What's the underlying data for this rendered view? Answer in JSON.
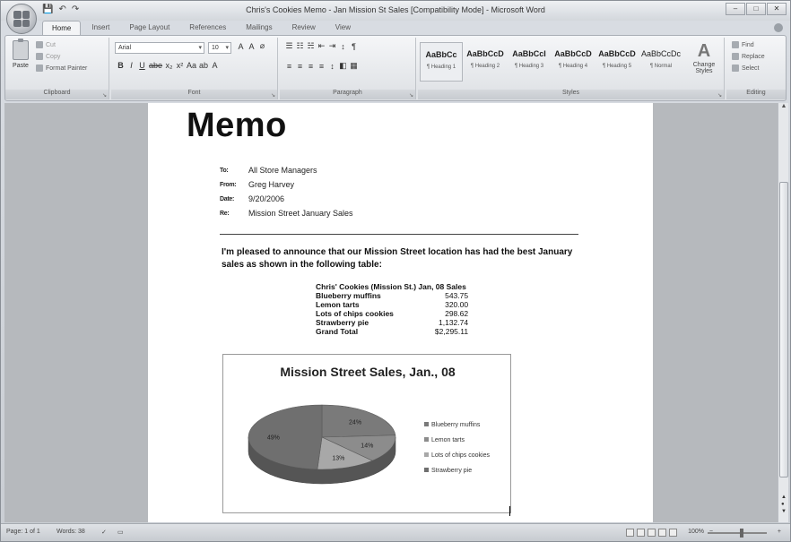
{
  "window": {
    "title": "Chris's Cookies Memo - Jan Mission St Sales [Compatibility Mode] - Microsoft Word",
    "controls": [
      "–",
      "□",
      "✕"
    ]
  },
  "quick_access": [
    "💾",
    "↶",
    "↷"
  ],
  "tabs": [
    "Home",
    "Insert",
    "Page Layout",
    "References",
    "Mailings",
    "Review",
    "View"
  ],
  "ribbon": {
    "clipboard": {
      "paste": "Paste",
      "cut": "Cut",
      "copy": "Copy",
      "format_painter": "Format Painter",
      "label": "Clipboard"
    },
    "font": {
      "family": "Arial",
      "size": "10",
      "label": "Font",
      "row1_extra": [
        "A",
        "A",
        "⌀"
      ],
      "row2": [
        "B",
        "I",
        "U",
        "abe",
        "x₂",
        "x²",
        "Aa",
        "ab",
        "A"
      ]
    },
    "paragraph": {
      "label": "Paragraph",
      "row1": [
        "☰",
        "☷",
        "☵",
        "⇤",
        "⇥",
        "↕",
        "¶"
      ],
      "row2": [
        "≡",
        "≡",
        "≡",
        "≡",
        "↕",
        "◧",
        "▦"
      ]
    },
    "styles": {
      "label": "Styles",
      "items": [
        {
          "sample": "AaBbCc",
          "name": "¶ Heading 1"
        },
        {
          "sample": "AaBbCcD",
          "name": "¶ Heading 2"
        },
        {
          "sample": "AaBbCcI",
          "name": "¶ Heading 3"
        },
        {
          "sample": "AaBbCcD",
          "name": "¶ Heading 4"
        },
        {
          "sample": "AaBbCcD",
          "name": "¶ Heading 5"
        },
        {
          "sample": "AaBbCcDc",
          "name": "¶ Normal"
        }
      ],
      "change_styles": "Change Styles"
    },
    "editing": {
      "label": "Editing",
      "find": "Find",
      "replace": "Replace",
      "select": "Select"
    }
  },
  "memo": {
    "title": "Memo",
    "to_key": "To:",
    "to": "All Store Managers",
    "from_key": "From:",
    "from": "Greg Harvey",
    "date_key": "Date:",
    "date": "9/20/2006",
    "re_key": "Re:",
    "re": "Mission Street January Sales",
    "intro": "I'm pleased to announce that our Mission Street location has had the best January sales as shown in the following table:"
  },
  "sales_table": {
    "header": "Chris' Cookies (Mission St.) Jan, 08 Sales",
    "rows": [
      {
        "item": "Blueberry muffins",
        "value": "543.75"
      },
      {
        "item": "Lemon tarts",
        "value": "320.00"
      },
      {
        "item": "Lots of chips cookies",
        "value": "298.62"
      },
      {
        "item": "Strawberry pie",
        "value": "1,132.74"
      }
    ],
    "total_label": "Grand Total",
    "total_value": "$2,295.11"
  },
  "chart_data": {
    "type": "pie",
    "title": "Mission Street Sales, Jan., 08",
    "categories": [
      "Blueberry muffins",
      "Lemon tarts",
      "Lots of chips cookies",
      "Strawberry pie"
    ],
    "values": [
      24,
      14,
      13,
      49
    ],
    "data_labels": [
      "24%",
      "14%",
      "13%",
      "49%"
    ],
    "colors": [
      "#7a7a7a",
      "#8c8c8c",
      "#a8a8a8",
      "#6f6f6f"
    ],
    "legend_position": "right"
  },
  "status": {
    "page": "Page: 1 of 1",
    "words": "Words: 38",
    "zoom": "100%"
  }
}
